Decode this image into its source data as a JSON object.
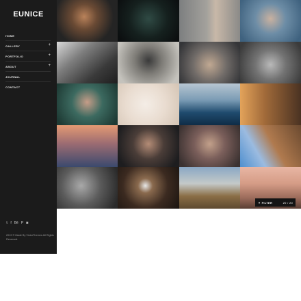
{
  "brand": {
    "logo": "EUNICE"
  },
  "nav": [
    {
      "label": "HOME",
      "has_sub": false
    },
    {
      "label": "GALLERY",
      "has_sub": true
    },
    {
      "label": "PORTFOLIO",
      "has_sub": true
    },
    {
      "label": "ABOUT",
      "has_sub": true
    },
    {
      "label": "JOURNAL",
      "has_sub": false
    },
    {
      "label": "CONTACT",
      "has_sub": false
    }
  ],
  "nav_plus": "+",
  "social": [
    {
      "icon": "twitter-icon",
      "glyph": "𝕥"
    },
    {
      "icon": "facebook-icon",
      "glyph": "f"
    },
    {
      "icon": "behance-icon",
      "glyph": "Bē"
    },
    {
      "icon": "pinterest-icon",
      "glyph": "P"
    },
    {
      "icon": "instagram-icon",
      "glyph": "◙"
    }
  ],
  "copyright": "2019 © Made By VictorThemes All Rights Reserved.",
  "gallery": {
    "filter_label": "FILTER",
    "filter_icon": "filter-icon",
    "counter": "20 / 20"
  },
  "colors": {
    "sidebar_bg": "#1b1b1b",
    "page_bg": "#ffffff"
  }
}
